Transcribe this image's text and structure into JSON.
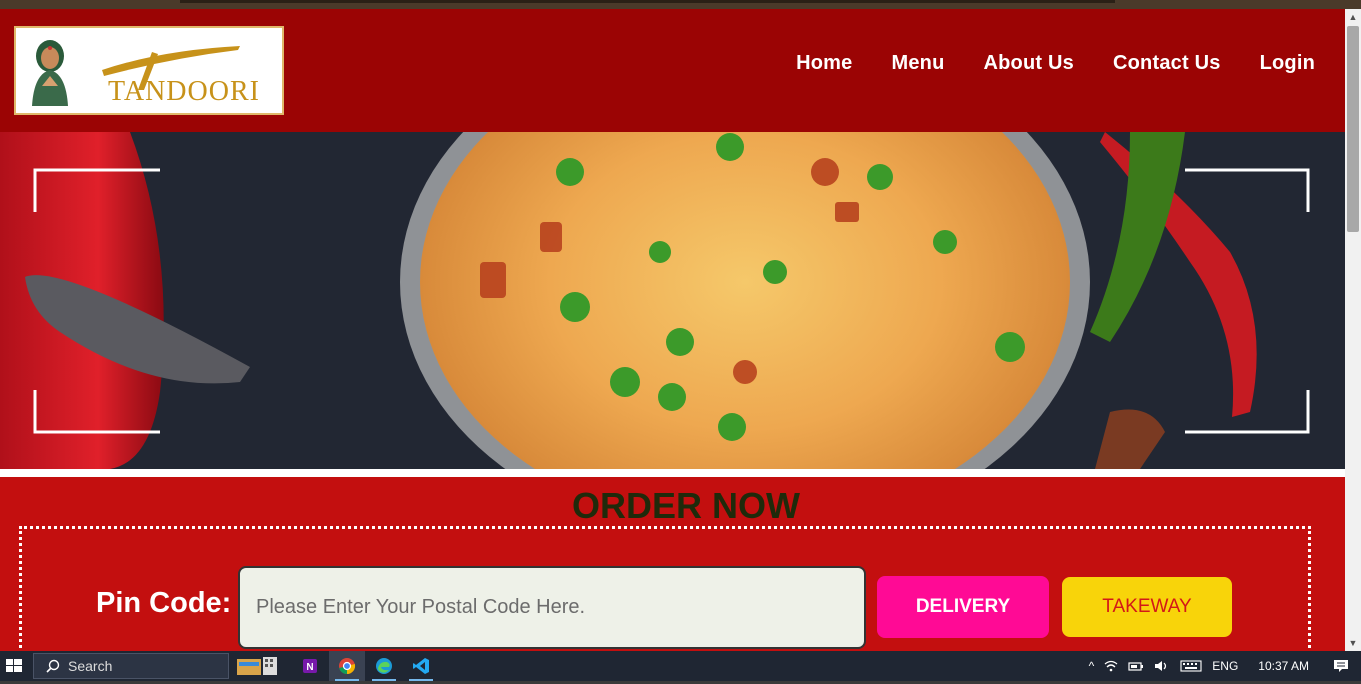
{
  "brand": {
    "logo_text": "TANDOORI"
  },
  "nav": [
    {
      "label": "Home"
    },
    {
      "label": "Menu"
    },
    {
      "label": "About Us"
    },
    {
      "label": "Contact Us"
    },
    {
      "label": "Login"
    }
  ],
  "order": {
    "title": "ORDER NOW",
    "pin_label": "Pin Code:",
    "pin_placeholder": "Please Enter Your Postal Code Here.",
    "delivery_label": "DELIVERY",
    "takeway_label": "TAKEWAY"
  },
  "colors": {
    "header": "#9b0404",
    "order_bg": "#c30f0f",
    "delivery": "#ff0a95",
    "takeway": "#f8d40a"
  },
  "taskbar": {
    "search_label": "Search",
    "language": "ENG",
    "time": "10:37 AM",
    "apps": [
      "file-explorer-icon",
      "onenote-icon",
      "chrome-icon",
      "edge-icon",
      "vscode-icon"
    ]
  }
}
